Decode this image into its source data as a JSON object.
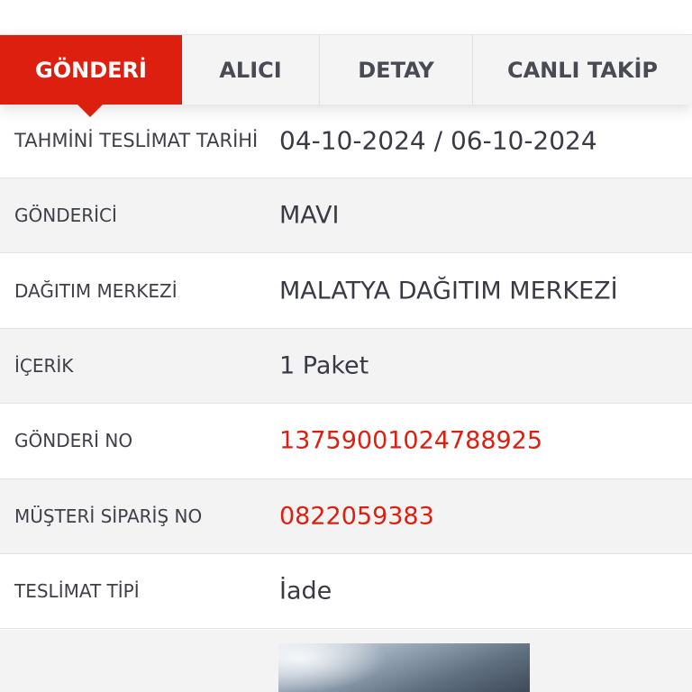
{
  "tabs": {
    "gonderi": "GÖNDERİ",
    "alici": "ALICI",
    "detay": "DETAY",
    "canli_takip": "CANLI TAKİP"
  },
  "shipment": {
    "estimated_delivery": {
      "label": "TAHMİNİ TESLİMAT TARİHİ",
      "value": "04-10-2024 / 06-10-2024"
    },
    "sender": {
      "label": "GÖNDERİCİ",
      "value": "MAVI"
    },
    "distribution_center": {
      "label": "DAĞITIM MERKEZİ",
      "value": "MALATYA DAĞITIM MERKEZİ"
    },
    "content": {
      "label": "İÇERİK",
      "value": "1 Paket"
    },
    "shipment_no": {
      "label": "GÖNDERİ NO",
      "value": "13759001024788925"
    },
    "customer_order_no": {
      "label": "MÜŞTERİ SİPARİŞ NO",
      "value": "0822059383"
    },
    "delivery_type": {
      "label": "TESLİMAT TİPİ",
      "value": "İade"
    }
  },
  "colors": {
    "accent": "#dd1f10",
    "text": "#3a3a44",
    "row_alt": "#f3f3f4"
  }
}
